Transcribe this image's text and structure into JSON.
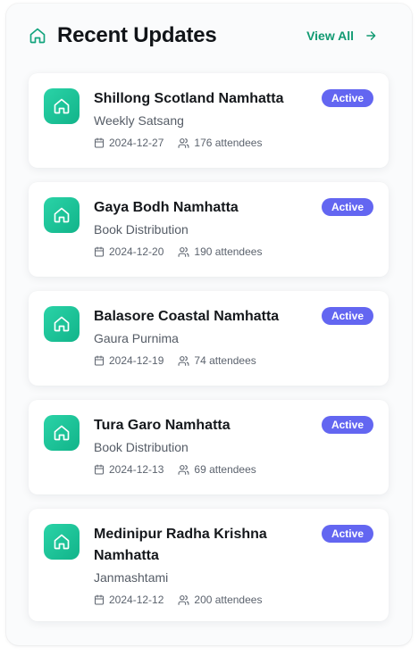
{
  "header": {
    "title": "Recent Updates",
    "view_all_label": "View All",
    "icon": "home-icon",
    "accent_color": "#119a72"
  },
  "badge_color": "#6366f1",
  "updates": [
    {
      "name": "Shillong Scotland Namhatta",
      "activity": "Weekly Satsang",
      "date": "2024-12-27",
      "attendees": "176 attendees",
      "status": "Active"
    },
    {
      "name": "Gaya Bodh Namhatta",
      "activity": "Book Distribution",
      "date": "2024-12-20",
      "attendees": "190 attendees",
      "status": "Active"
    },
    {
      "name": "Balasore Coastal Namhatta",
      "activity": "Gaura Purnima",
      "date": "2024-12-19",
      "attendees": "74 attendees",
      "status": "Active"
    },
    {
      "name": "Tura Garo Namhatta",
      "activity": "Book Distribution",
      "date": "2024-12-13",
      "attendees": "69 attendees",
      "status": "Active"
    },
    {
      "name": "Medinipur Radha Krishna Namhatta",
      "activity": "Janmashtami",
      "date": "2024-12-12",
      "attendees": "200 attendees",
      "status": "Active"
    }
  ]
}
